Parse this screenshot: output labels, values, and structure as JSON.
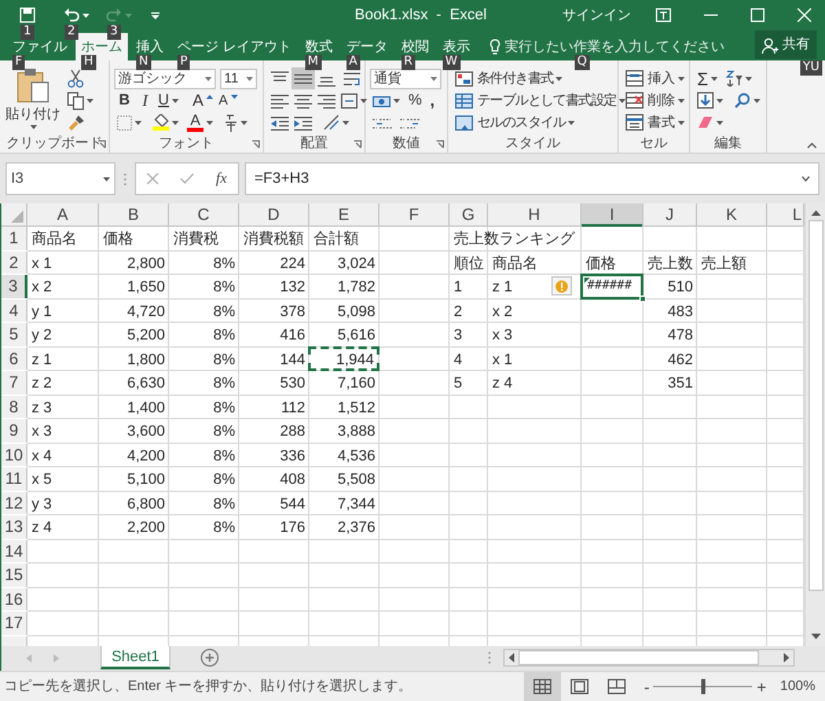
{
  "title_bar": {
    "title": "Book1.xlsx  -  Excel",
    "sign_in": "サインイン",
    "quick_access": [
      {
        "keytip": "1",
        "disabled": false
      },
      {
        "keytip": "2",
        "disabled": false
      },
      {
        "keytip": "3",
        "disabled": true
      }
    ]
  },
  "tabs": [
    {
      "label": "ファイル",
      "keytip": "F",
      "selected": false
    },
    {
      "label": "ホーム",
      "keytip": "H",
      "selected": true
    },
    {
      "label": "挿入",
      "keytip": "N",
      "selected": false
    },
    {
      "label": "ページ レイアウト",
      "keytip": "P",
      "selected": false
    },
    {
      "label": "数式",
      "keytip": "M",
      "selected": false
    },
    {
      "label": "データ",
      "keytip": "A",
      "selected": false
    },
    {
      "label": "校閲",
      "keytip": "R",
      "selected": false
    },
    {
      "label": "表示",
      "keytip": "W",
      "selected": false
    }
  ],
  "tell_me": {
    "placeholder": "実行したい作業を入力してください",
    "keytip": "Q"
  },
  "share": {
    "label": "共有",
    "keytip": "YU"
  },
  "ribbon": {
    "paste": "貼り付け",
    "font_name": "游ゴシック",
    "font_size": "11",
    "bold": "B",
    "italic": "I",
    "underline": "U",
    "grow_font": "A",
    "shrink_font": "A",
    "font_color": "A",
    "number_format": "通貨",
    "percent": "%",
    "comma": ",",
    "styles": [
      "条件付き書式",
      "テーブルとして書式設定",
      "セルのスタイル"
    ],
    "cells": [
      "挿入",
      "削除",
      "書式"
    ],
    "sum": "Σ",
    "groups": [
      {
        "label": "クリップボード",
        "launcher": true
      },
      {
        "label": "フォント",
        "launcher": true
      },
      {
        "label": "配置",
        "launcher": true
      },
      {
        "label": "数値",
        "launcher": true
      },
      {
        "label": "スタイル",
        "launcher": false
      },
      {
        "label": "セル",
        "launcher": false
      },
      {
        "label": "編集",
        "launcher": false
      }
    ]
  },
  "formula_bar": {
    "name_box": "I3",
    "function_button": "fx",
    "formula": "=F3+H3"
  },
  "sheet": {
    "columns": [
      {
        "label": "A",
        "selected": false
      },
      {
        "label": "B",
        "selected": false
      },
      {
        "label": "C",
        "selected": false
      },
      {
        "label": "D",
        "selected": false
      },
      {
        "label": "E",
        "selected": false
      },
      {
        "label": "F",
        "selected": false
      },
      {
        "label": "G",
        "selected": false
      },
      {
        "label": "H",
        "selected": false
      },
      {
        "label": "I",
        "selected": true
      },
      {
        "label": "J",
        "selected": false
      },
      {
        "label": "K",
        "selected": false
      },
      {
        "label": "L",
        "selected": false
      }
    ],
    "rows": [
      {
        "label": "1",
        "selected": false,
        "cells": [
          {
            "text": "商品名",
            "kind": "text"
          },
          {
            "text": "価格",
            "kind": "text"
          },
          {
            "text": "消費税",
            "kind": "text"
          },
          {
            "text": "消費税額",
            "kind": "text"
          },
          {
            "text": "合計額",
            "kind": "text"
          },
          {
            "kind": "empty"
          },
          {
            "text": "売上数ランキング",
            "kind": "text"
          }
        ]
      },
      {
        "label": "2",
        "selected": false,
        "cells": [
          {
            "text": "x 1",
            "kind": "text"
          },
          {
            "text": "2,800",
            "kind": "number"
          },
          {
            "text": "8%",
            "kind": "number"
          },
          {
            "text": "224",
            "kind": "number"
          },
          {
            "text": "3,024",
            "kind": "number"
          },
          {
            "kind": "empty"
          },
          {
            "text": "順位",
            "kind": "text"
          },
          {
            "text": "商品名",
            "kind": "text"
          },
          {
            "text": "価格",
            "kind": "text"
          },
          {
            "text": "売上数",
            "kind": "text"
          },
          {
            "text": "売上額",
            "kind": "text"
          }
        ]
      },
      {
        "label": "3",
        "selected": true,
        "cells": [
          {
            "text": "x 2",
            "kind": "text"
          },
          {
            "text": "1,650",
            "kind": "number"
          },
          {
            "text": "8%",
            "kind": "number"
          },
          {
            "text": "132",
            "kind": "number"
          },
          {
            "text": "1,782",
            "kind": "number"
          },
          {
            "kind": "empty"
          },
          {
            "text": "1",
            "kind": "text"
          },
          {
            "text": "z 1",
            "kind": "text"
          },
          {
            "text": "######",
            "kind": "error"
          },
          {
            "text": "510",
            "kind": "number"
          }
        ]
      },
      {
        "label": "4",
        "selected": false,
        "cells": [
          {
            "text": "y 1",
            "kind": "text"
          },
          {
            "text": "4,720",
            "kind": "number"
          },
          {
            "text": "8%",
            "kind": "number"
          },
          {
            "text": "378",
            "kind": "number"
          },
          {
            "text": "5,098",
            "kind": "number"
          },
          {
            "kind": "empty"
          },
          {
            "text": "2",
            "kind": "text"
          },
          {
            "text": "x 2",
            "kind": "text"
          },
          {
            "kind": "empty"
          },
          {
            "text": "483",
            "kind": "number"
          }
        ]
      },
      {
        "label": "5",
        "selected": false,
        "cells": [
          {
            "text": "y 2",
            "kind": "text"
          },
          {
            "text": "5,200",
            "kind": "number"
          },
          {
            "text": "8%",
            "kind": "number"
          },
          {
            "text": "416",
            "kind": "number"
          },
          {
            "text": "5,616",
            "kind": "number"
          },
          {
            "kind": "empty"
          },
          {
            "text": "3",
            "kind": "text"
          },
          {
            "text": "x 3",
            "kind": "text"
          },
          {
            "kind": "empty"
          },
          {
            "text": "478",
            "kind": "number"
          }
        ]
      },
      {
        "label": "6",
        "selected": false,
        "cells": [
          {
            "text": "z 1",
            "kind": "text"
          },
          {
            "text": "1,800",
            "kind": "number"
          },
          {
            "text": "8%",
            "kind": "number"
          },
          {
            "text": "144",
            "kind": "number"
          },
          {
            "text": "1,944",
            "kind": "copied"
          },
          {
            "kind": "empty"
          },
          {
            "text": "4",
            "kind": "text"
          },
          {
            "text": "x 1",
            "kind": "text"
          },
          {
            "kind": "empty"
          },
          {
            "text": "462",
            "kind": "number"
          }
        ]
      },
      {
        "label": "7",
        "selected": false,
        "cells": [
          {
            "text": "z 2",
            "kind": "text"
          },
          {
            "text": "6,630",
            "kind": "number"
          },
          {
            "text": "8%",
            "kind": "number"
          },
          {
            "text": "530",
            "kind": "number"
          },
          {
            "text": "7,160",
            "kind": "number"
          },
          {
            "kind": "empty"
          },
          {
            "text": "5",
            "kind": "text"
          },
          {
            "text": "z 4",
            "kind": "text"
          },
          {
            "kind": "empty"
          },
          {
            "text": "351",
            "kind": "number"
          }
        ]
      },
      {
        "label": "8",
        "selected": false,
        "cells": [
          {
            "text": "z 3",
            "kind": "text"
          },
          {
            "text": "1,400",
            "kind": "number"
          },
          {
            "text": "8%",
            "kind": "number"
          },
          {
            "text": "112",
            "kind": "number"
          },
          {
            "text": "1,512",
            "kind": "number"
          }
        ]
      },
      {
        "label": "9",
        "selected": false,
        "cells": [
          {
            "text": "x 3",
            "kind": "text"
          },
          {
            "text": "3,600",
            "kind": "number"
          },
          {
            "text": "8%",
            "kind": "number"
          },
          {
            "text": "288",
            "kind": "number"
          },
          {
            "text": "3,888",
            "kind": "number"
          }
        ]
      },
      {
        "label": "10",
        "selected": false,
        "cells": [
          {
            "text": "x 4",
            "kind": "text"
          },
          {
            "text": "4,200",
            "kind": "number"
          },
          {
            "text": "8%",
            "kind": "number"
          },
          {
            "text": "336",
            "kind": "number"
          },
          {
            "text": "4,536",
            "kind": "number"
          }
        ]
      },
      {
        "label": "11",
        "selected": false,
        "cells": [
          {
            "text": "x 5",
            "kind": "text"
          },
          {
            "text": "5,100",
            "kind": "number"
          },
          {
            "text": "8%",
            "kind": "number"
          },
          {
            "text": "408",
            "kind": "number"
          },
          {
            "text": "5,508",
            "kind": "number"
          }
        ]
      },
      {
        "label": "12",
        "selected": false,
        "cells": [
          {
            "text": "y 3",
            "kind": "text"
          },
          {
            "text": "6,800",
            "kind": "number"
          },
          {
            "text": "8%",
            "kind": "number"
          },
          {
            "text": "544",
            "kind": "number"
          },
          {
            "text": "7,344",
            "kind": "number"
          }
        ]
      },
      {
        "label": "13",
        "selected": false,
        "cells": [
          {
            "text": "z 4",
            "kind": "text"
          },
          {
            "text": "2,200",
            "kind": "number"
          },
          {
            "text": "8%",
            "kind": "number"
          },
          {
            "text": "176",
            "kind": "number"
          },
          {
            "text": "2,376",
            "kind": "number"
          }
        ]
      },
      {
        "label": "14",
        "selected": false,
        "cells": []
      },
      {
        "label": "15",
        "selected": false,
        "cells": []
      },
      {
        "label": "16",
        "selected": false,
        "cells": []
      },
      {
        "label": "17",
        "selected": false,
        "cells": []
      }
    ]
  },
  "sheet_tabs": [
    {
      "label": "Sheet1",
      "selected": true
    }
  ],
  "status_bar": {
    "message": "コピー先を選択し、Enter キーを押すか、貼り付けを選択します。",
    "views": [
      {
        "selected": true
      },
      {
        "selected": false
      },
      {
        "selected": false
      }
    ],
    "zoom_out": "-",
    "zoom_in": "+",
    "zoom": {
      "level": 0.5,
      "reading": "100%"
    }
  }
}
